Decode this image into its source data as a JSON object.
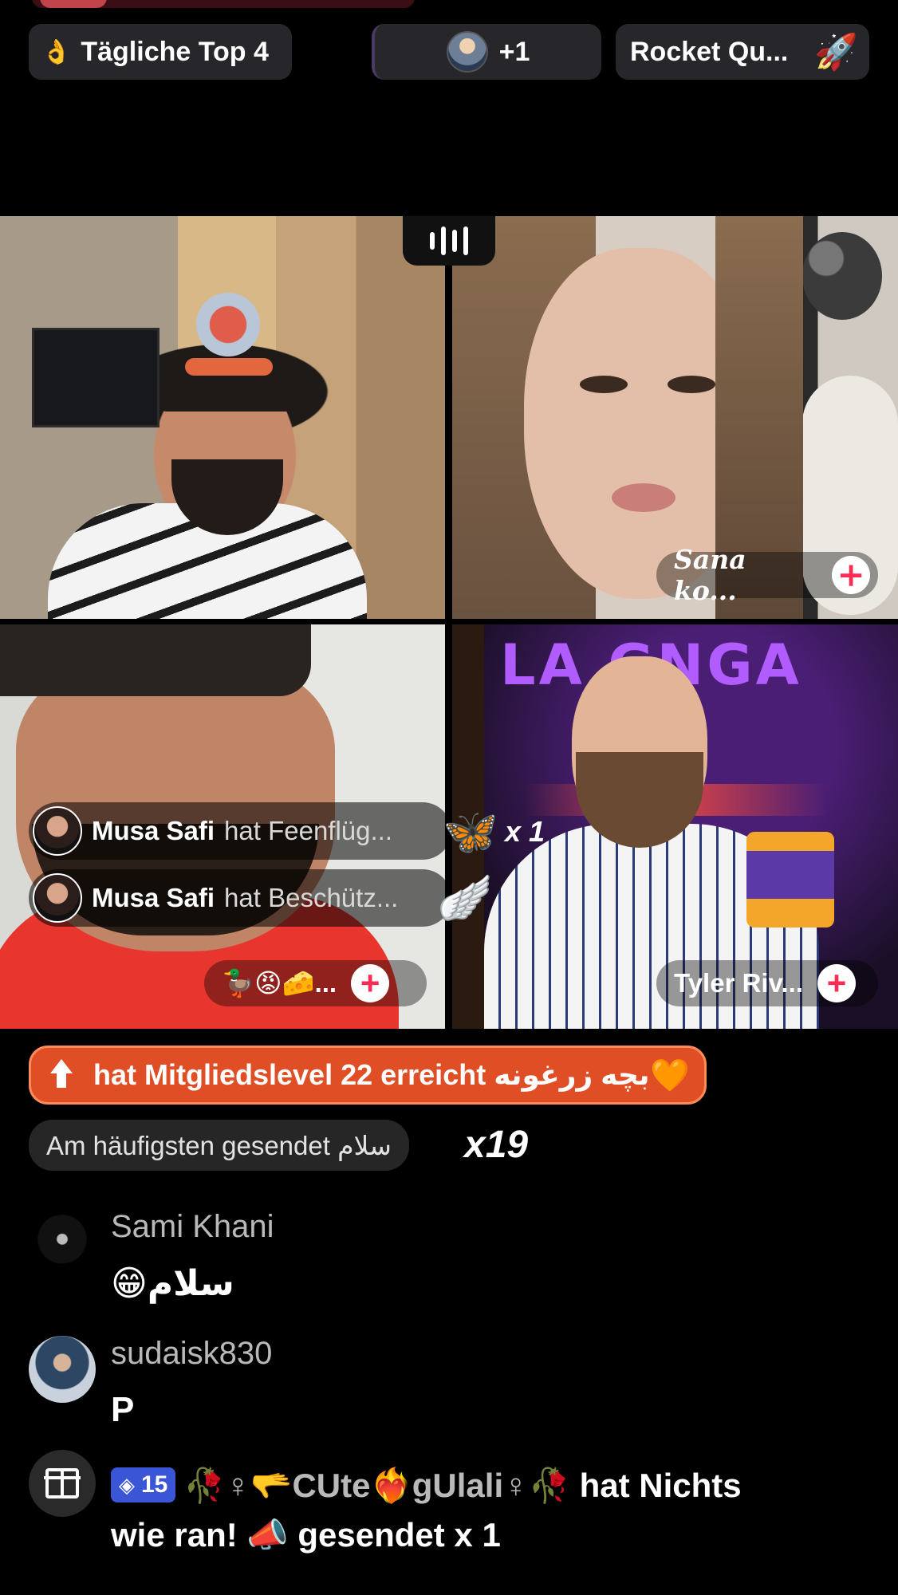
{
  "top_bar": {
    "daily_top_icon": "flame-hand-icon",
    "daily_top_label": "Tägliche Top 4",
    "guests_label": "+1",
    "rocket_label": "Rocket Qu...",
    "rocket_icon": "🚀"
  },
  "tiles": {
    "sana_label": "Sana ko...",
    "emoji_label": "🦆😡🧀...",
    "tyler_label": "Tyler Riv...",
    "neon_text": "LA GNGA"
  },
  "gift_feed": [
    {
      "user": "Musa Safi",
      "action": "hat Feenflüg...",
      "icon": "🦋",
      "count": "x 1"
    },
    {
      "user": "Musa Safi",
      "action": "hat Beschütz...",
      "icon": "🪽"
    }
  ],
  "level_up": {
    "text": "hat Mitgliedslevel 22 erreicht بچه زرغونه",
    "heart": "🧡"
  },
  "top_sent": {
    "label": "Am häufigsten gesendet سلام",
    "count": "x19"
  },
  "comments": [
    {
      "user": "Sami Khani",
      "text": "😁سلام"
    },
    {
      "user": "sudaisk830",
      "text": "P"
    }
  ],
  "gift_message": {
    "badge_level": "15",
    "user": "🥀♀🫳CUte❤️‍🔥gUlali♀🥀",
    "text_1": "hat Nichts",
    "text_2": "wie ran!",
    "gift_icon": "📣",
    "text_3": "gesendet x 1"
  },
  "colors": {
    "level_up_bg": "#e04e26",
    "follow_plus": "#fe2c55",
    "badge_blue": "#3a55d6"
  }
}
